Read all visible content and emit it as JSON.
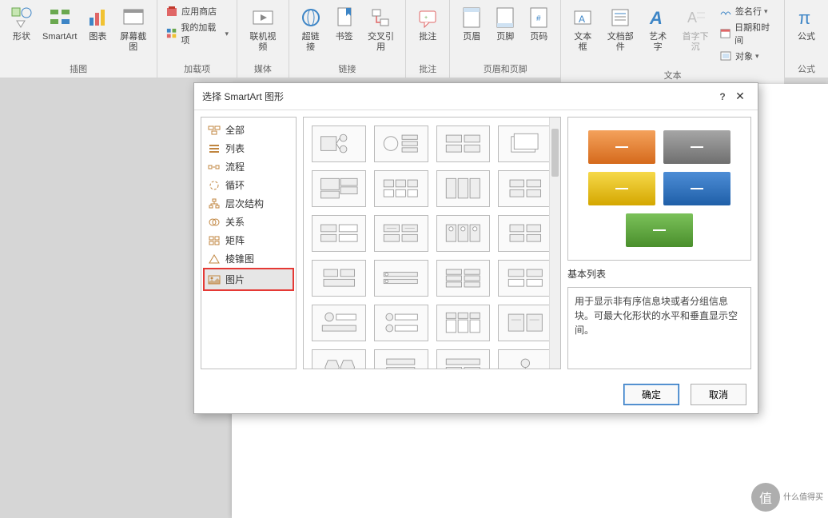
{
  "ribbon": {
    "groups": [
      {
        "label": "插图",
        "items": [
          {
            "label": "形状",
            "icon": "shapes"
          },
          {
            "label": "SmartArt",
            "icon": "smartart"
          },
          {
            "label": "图表",
            "icon": "chart"
          },
          {
            "label": "屏幕截图",
            "icon": "screenshot"
          }
        ]
      },
      {
        "label": "加载项",
        "items": [
          {
            "label": "应用商店",
            "icon": "store",
            "small": true
          },
          {
            "label": "我的加载项",
            "icon": "addins",
            "small": true
          }
        ]
      },
      {
        "label": "媒体",
        "items": [
          {
            "label": "联机视频",
            "icon": "video"
          }
        ]
      },
      {
        "label": "链接",
        "items": [
          {
            "label": "超链接",
            "icon": "hyperlink"
          },
          {
            "label": "书签",
            "icon": "bookmark"
          },
          {
            "label": "交叉引用",
            "icon": "crossref"
          }
        ]
      },
      {
        "label": "批注",
        "items": [
          {
            "label": "批注",
            "icon": "comment"
          }
        ]
      },
      {
        "label": "页眉和页脚",
        "items": [
          {
            "label": "页眉",
            "icon": "header"
          },
          {
            "label": "页脚",
            "icon": "footer"
          },
          {
            "label": "页码",
            "icon": "pagenum"
          }
        ]
      },
      {
        "label": "文本",
        "items": [
          {
            "label": "文本框",
            "icon": "textbox"
          },
          {
            "label": "文档部件",
            "icon": "quickparts"
          },
          {
            "label": "艺术字",
            "icon": "wordart"
          },
          {
            "label": "首字下沉",
            "icon": "dropcap",
            "disabled": true
          },
          {
            "label": "签名行",
            "icon": "signature",
            "small": true
          },
          {
            "label": "日期和时间",
            "icon": "datetime",
            "small": true
          },
          {
            "label": "对象",
            "icon": "object",
            "small": true
          }
        ]
      },
      {
        "label": "公式",
        "items": [
          {
            "label": "公式",
            "icon": "equation"
          }
        ]
      }
    ]
  },
  "dialog": {
    "title": "选择 SmartArt 图形",
    "help_char": "?",
    "close_char": "✕",
    "categories": [
      {
        "label": "全部",
        "icon": "all"
      },
      {
        "label": "列表",
        "icon": "list"
      },
      {
        "label": "流程",
        "icon": "process"
      },
      {
        "label": "循环",
        "icon": "cycle"
      },
      {
        "label": "层次结构",
        "icon": "hierarchy"
      },
      {
        "label": "关系",
        "icon": "relationship"
      },
      {
        "label": "矩阵",
        "icon": "matrix"
      },
      {
        "label": "棱锥图",
        "icon": "pyramid"
      },
      {
        "label": "图片",
        "icon": "picture",
        "highlighted": true
      }
    ],
    "preview": {
      "title": "基本列表",
      "description": "用于显示非有序信息块或者分组信息块。可最大化形状的水平和垂直显示空间。",
      "tiles": [
        {
          "color": "#e8802f"
        },
        {
          "color": "#8a8a8a"
        },
        {
          "color": "#e6b700"
        },
        {
          "color": "#2a6fba"
        },
        {
          "color": "#5da53a"
        }
      ]
    },
    "ok": "确定",
    "cancel": "取消"
  },
  "watermark": {
    "text1": "什么值得买",
    "text2": "值"
  }
}
